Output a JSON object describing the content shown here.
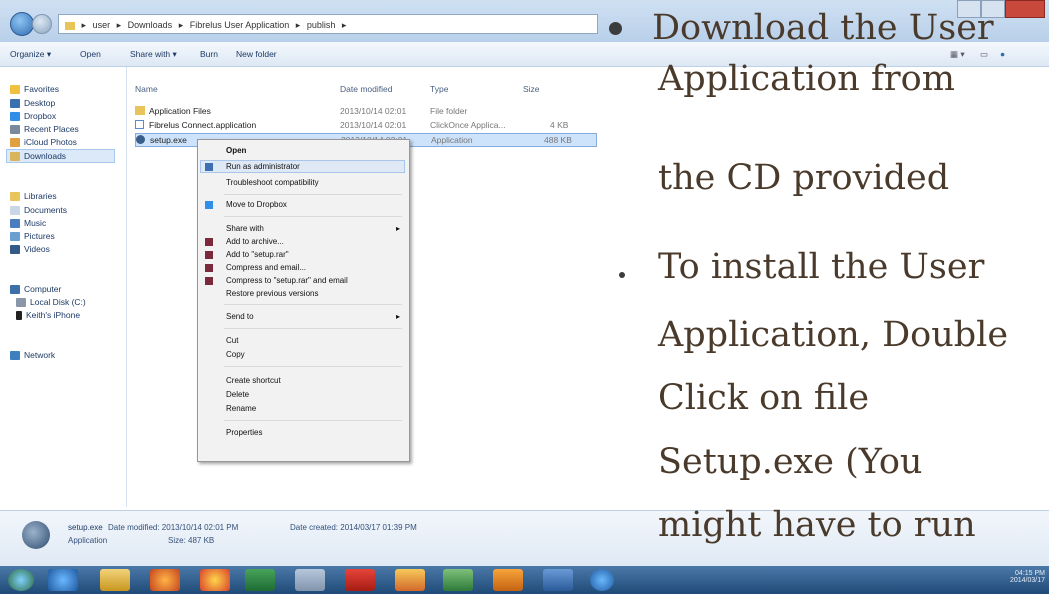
{
  "window": {
    "address_parts": [
      "user",
      "Downloads",
      "Fibrelus User Application",
      "publish"
    ],
    "title_buttons": [
      "minimize",
      "maximize",
      "close"
    ]
  },
  "toolbar": {
    "items": [
      "Organize ▾",
      "Open",
      "Share with ▾",
      "Burn",
      "New folder"
    ]
  },
  "nav": {
    "favorites": [
      "Favorites",
      "Desktop",
      "Dropbox",
      "Recent Places",
      "iCloud Photos",
      "Downloads"
    ],
    "libraries": [
      "Libraries",
      "Documents",
      "Music",
      "Pictures",
      "Videos"
    ],
    "computer": [
      "Computer",
      "Local Disk (C:)",
      "Keith's iPhone"
    ],
    "network": [
      "Network"
    ]
  },
  "columns": [
    "Name",
    "Date modified",
    "Type",
    "Size"
  ],
  "files": [
    {
      "name": "Application Files",
      "date": "2013/10/14 02:01",
      "type": "File folder",
      "size": ""
    },
    {
      "name": "Fibrelus Connect.application",
      "date": "2013/10/14 02:01",
      "type": "ClickOnce Applica...",
      "size": "4 KB"
    },
    {
      "name": "setup.exe",
      "date": "2013/10/14 02:01",
      "type": "Application",
      "size": "488 KB"
    }
  ],
  "context_menu": {
    "items": [
      {
        "label": "Open",
        "bold": true
      },
      {
        "label": "Run as administrator"
      },
      {
        "label": "Troubleshoot compatibility"
      },
      {
        "label": "Move to Dropbox"
      },
      {
        "label": "Share with",
        "submenu": true
      },
      {
        "label": "Add to archive..."
      },
      {
        "label": "Add to \"setup.rar\""
      },
      {
        "label": "Compress and email..."
      },
      {
        "label": "Compress to \"setup.rar\" and email"
      },
      {
        "label": "Restore previous versions"
      },
      {
        "label": "Send to",
        "submenu": true
      },
      {
        "label": "Cut"
      },
      {
        "label": "Copy"
      },
      {
        "label": "Create shortcut"
      },
      {
        "label": "Delete"
      },
      {
        "label": "Rename"
      },
      {
        "label": "Properties"
      }
    ]
  },
  "details": {
    "filename": "setup.exe",
    "kind": "Application",
    "date_modified": "Date modified: 2013/10/14 02:01 PM",
    "size": "Size: 487 KB",
    "date_created": "Date created: 2014/03/17 01:39 PM"
  },
  "taskbar": {
    "clock_time": "04:15 PM",
    "clock_date": "2014/03/17"
  },
  "slide_bullets": {
    "bullet1_lines": [
      "Download the User",
      "Application from",
      "the CD provided"
    ],
    "bullet2_lines": [
      "To install the User",
      "Application, Double",
      "Click on file",
      "Setup.exe (You",
      "might have to run"
    ]
  }
}
